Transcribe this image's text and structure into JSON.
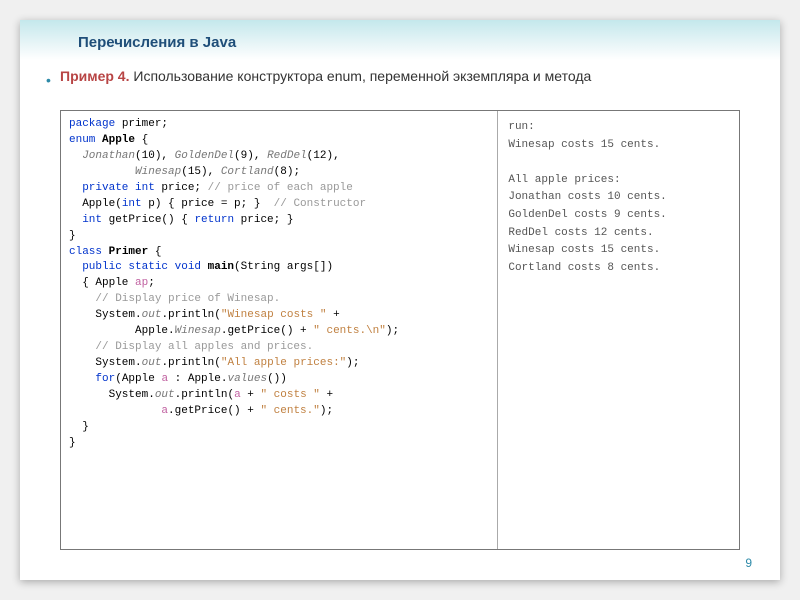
{
  "title": "Перечисления в Java",
  "subtitle_prefix": "Пример 4. ",
  "subtitle_rest": "Использование конструктора enum, переменной экземпляра и метода",
  "page_number": "9",
  "code": {
    "l1a": "package",
    "l1b": " primer;",
    "l2a": "enum",
    "l2b": " Apple",
    "l2c": " {",
    "l3a": "  Jonathan",
    "l3b": "(10), ",
    "l3c": "GoldenDel",
    "l3d": "(9), ",
    "l3e": "RedDel",
    "l3f": "(12),",
    "l4a": "          Winesap",
    "l4b": "(15), ",
    "l4c": "Cortland",
    "l4d": "(8);",
    "l5a": "  private int",
    "l5b": " price; ",
    "l5c": "// price of each apple",
    "l6a": "  Apple(",
    "l6b": "int",
    "l6c": " p) { price = p; }  ",
    "l6d": "// Constructor",
    "l7a": "  int",
    "l7b": " getPrice() { ",
    "l7c": "return",
    "l7d": " price; }",
    "l8": "}",
    "l9a": "class",
    "l9b": " Primer",
    "l9c": " {",
    "l10a": "  public static void",
    "l10b": " main",
    "l10c": "(String args[])",
    "l11a": "  { Apple ",
    "l11b": "ap",
    "l11c": ";",
    "l12": "    // Display price of Winesap.",
    "l13a": "    System.",
    "l13b": "out",
    "l13c": ".println(",
    "l13d": "\"Winesap costs \"",
    "l13e": " +",
    "l14a": "          Apple.",
    "l14b": "Winesap",
    "l14c": ".getPrice() + ",
    "l14d": "\" cents.\\n\"",
    "l14e": ");",
    "l15": "    // Display all apples and prices.",
    "l16a": "    System.",
    "l16b": "out",
    "l16c": ".println(",
    "l16d": "\"All apple prices:\"",
    "l16e": ");",
    "l17a": "    for",
    "l17b": "(Apple ",
    "l17c": "a",
    "l17d": " : Apple.",
    "l17e": "values",
    "l17f": "())",
    "l18a": "      System.",
    "l18b": "out",
    "l18c": ".println(",
    "l18d": "a",
    "l18e": " + ",
    "l18f": "\" costs \"",
    "l18g": " +",
    "l19a": "              ",
    "l19b": "a",
    "l19c": ".getPrice() + ",
    "l19d": "\" cents.\"",
    "l19e": ");",
    "l20": "  }",
    "l21": "}"
  },
  "output": "run:\nWinesap costs 15 cents.\n\nAll apple prices:\nJonathan costs 10 cents.\nGoldenDel costs 9 cents.\nRedDel costs 12 cents.\nWinesap costs 15 cents.\nCortland costs 8 cents."
}
